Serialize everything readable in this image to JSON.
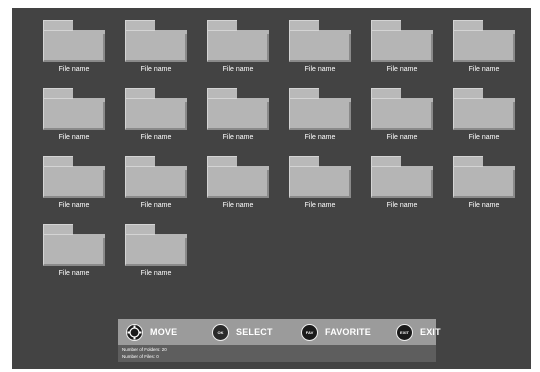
{
  "folders": [
    {
      "label": "File name"
    },
    {
      "label": "File name"
    },
    {
      "label": "File name"
    },
    {
      "label": "File name"
    },
    {
      "label": "File name"
    },
    {
      "label": "File name"
    },
    {
      "label": "File name"
    },
    {
      "label": "File name"
    },
    {
      "label": "File name"
    },
    {
      "label": "File name"
    },
    {
      "label": "File name"
    },
    {
      "label": "File name"
    },
    {
      "label": "File name"
    },
    {
      "label": "File name"
    },
    {
      "label": "File name"
    },
    {
      "label": "File name"
    },
    {
      "label": "File name"
    },
    {
      "label": "File name"
    },
    {
      "label": "File name"
    },
    {
      "label": "File name"
    }
  ],
  "nav": {
    "move_label": "MOVE",
    "move_icon": "dpad-icon",
    "select_label": "SELECT",
    "select_icon_text": "OK",
    "favorite_label": "FAVORITE",
    "favorite_icon_text": "FAV",
    "exit_label": "EXIT",
    "exit_icon_text": "EXIT"
  },
  "status": {
    "folders_line": "Number of Folders: 20",
    "files_line": "Number of Files: 0"
  },
  "colors": {
    "screen_bg": "#434343",
    "folder_fill": "#b5b5b5",
    "nav_bar": "#9b9b9b",
    "status_bar": "#5e5e5e",
    "text": "#ffffff"
  }
}
